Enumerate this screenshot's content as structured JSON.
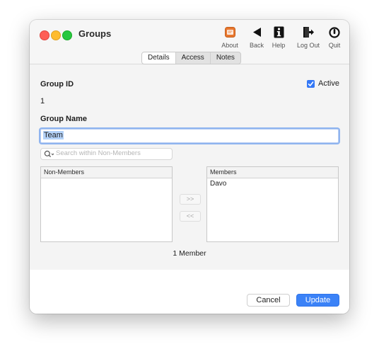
{
  "window": {
    "title": "Groups"
  },
  "toolbar": [
    {
      "label": "About",
      "icon": "about-icon"
    },
    {
      "label": "Back",
      "icon": "back-arrow-icon"
    },
    {
      "label": "Help",
      "icon": "info-icon"
    },
    {
      "label": "Log Out",
      "icon": "logout-icon"
    },
    {
      "label": "Quit",
      "icon": "power-icon"
    }
  ],
  "tabs": [
    {
      "label": "Details",
      "active": true
    },
    {
      "label": "Access",
      "active": false
    },
    {
      "label": "Notes",
      "active": false
    }
  ],
  "form": {
    "group_id_label": "Group ID",
    "group_id_value": "1",
    "active_label": "Active",
    "active_checked": true,
    "group_name_label": "Group Name",
    "group_name_value": "Team",
    "search_placeholder": "Search within Non-Members"
  },
  "lists": {
    "non_members": {
      "header": "Non-Members",
      "items": []
    },
    "members": {
      "header": "Members",
      "items": [
        "Davo"
      ]
    }
  },
  "move_buttons": {
    "add": ">>",
    "remove": "<<"
  },
  "member_count": "1 Member",
  "buttons": {
    "cancel": "Cancel",
    "update": "Update"
  },
  "colors": {
    "accent": "#3b82f7",
    "checkbox": "#3478f6",
    "close": "#fe5f57",
    "minimize": "#febc2e",
    "zoom": "#28c840"
  }
}
